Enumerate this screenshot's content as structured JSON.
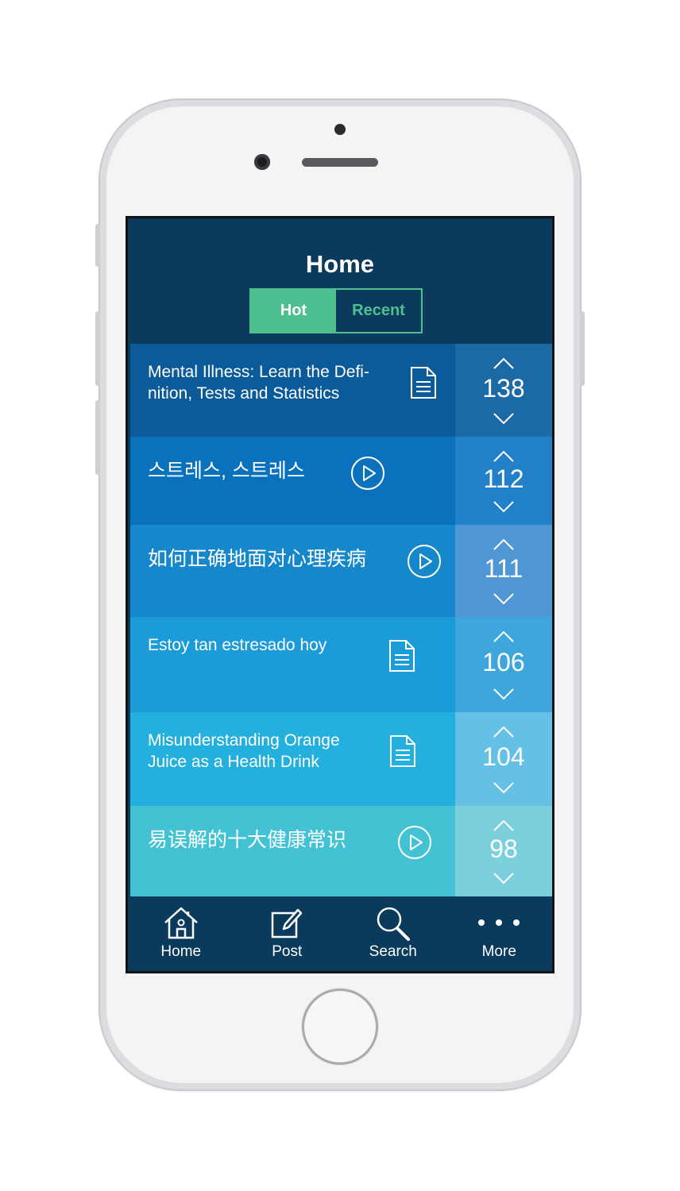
{
  "header": {
    "title": "Home"
  },
  "segment": {
    "hot": "Hot",
    "recent": "Recent",
    "selected": "Hot"
  },
  "feed": [
    {
      "title": "Mental Illness: Learn the Defi-\nnition, Tests and Statistics",
      "type": "article",
      "icon": "document-icon",
      "votes": "138",
      "bg": "#0b5a9a",
      "vote_bg": "#1c6aa5"
    },
    {
      "title": "스트레스, 스트레스",
      "type": "video",
      "icon": "play-circle-icon",
      "votes": "112",
      "bg": "#0a72bd",
      "vote_bg": "#2180c7"
    },
    {
      "title": "如何正确地面对心理疾病",
      "type": "video",
      "icon": "play-circle-icon",
      "votes": "111",
      "bg": "#1687ca",
      "vote_bg": "#4f96d4"
    },
    {
      "title": "Estoy tan estresado hoy",
      "type": "article",
      "icon": "document-icon",
      "votes": "106",
      "bg": "#1b9bd7",
      "vote_bg": "#3ea6dd"
    },
    {
      "title": "Misunderstanding Orange\nJuice as a Health Drink",
      "type": "article",
      "icon": "document-icon",
      "votes": "104",
      "bg": "#23b0de",
      "vote_bg": "#64c0e4"
    },
    {
      "title": "易误解的十大健康常识",
      "type": "video",
      "icon": "play-circle-icon",
      "votes": "98",
      "bg": "#43c2d4",
      "vote_bg": "#7ccfdd"
    }
  ],
  "tabbar": [
    {
      "label": "Home",
      "icon": "house-icon"
    },
    {
      "label": "Post",
      "icon": "compose-icon"
    },
    {
      "label": "Search",
      "icon": "magnifier-icon"
    },
    {
      "label": "More",
      "icon": "more-dots-icon"
    }
  ]
}
